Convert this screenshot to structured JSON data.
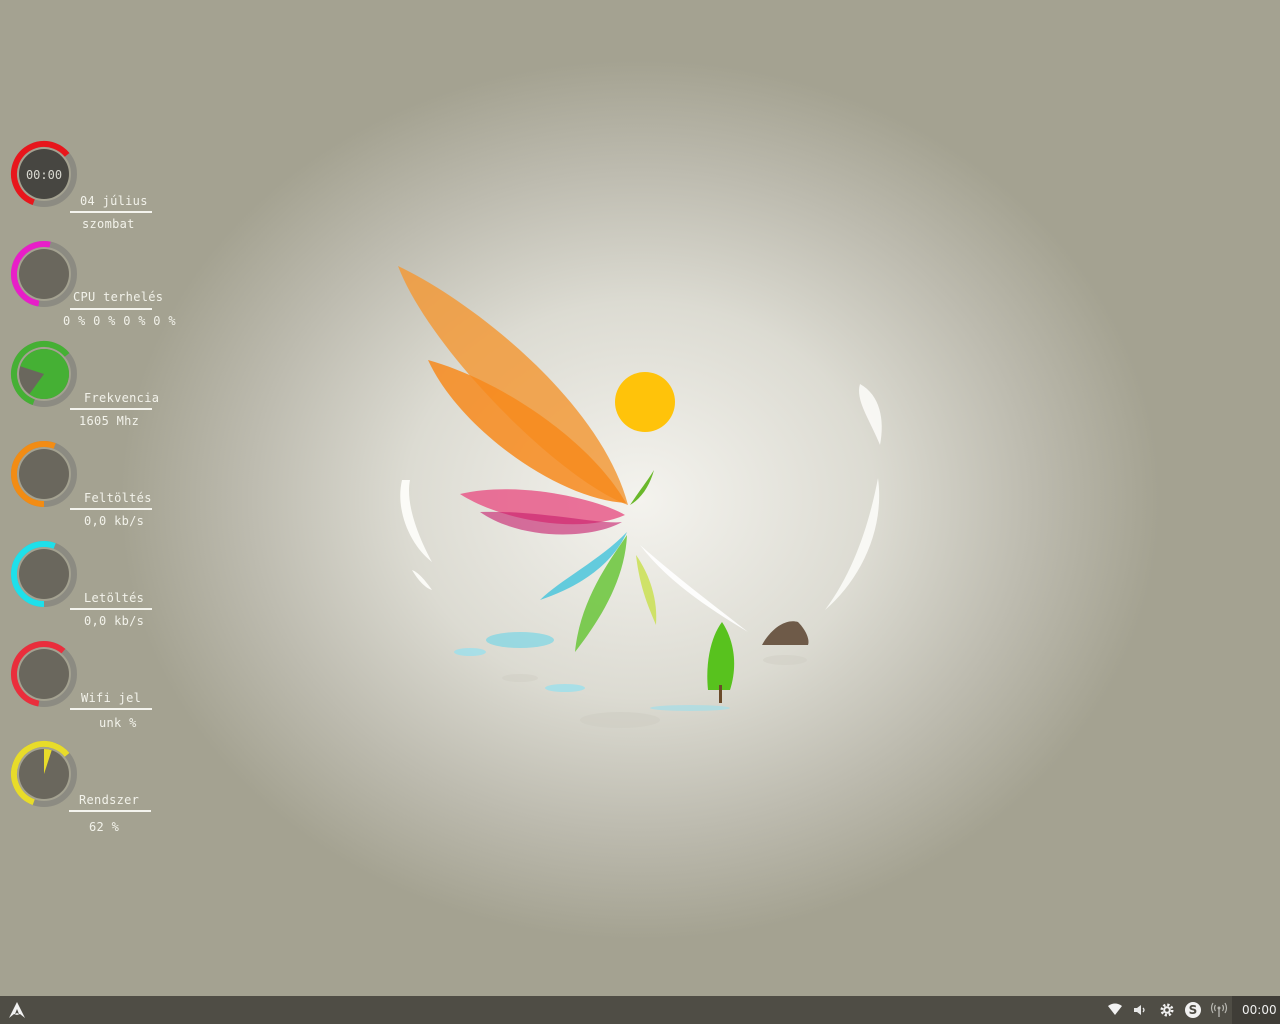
{
  "colors": {
    "clock_ring": "#e8161c",
    "cpu_ring": "#e81ec8",
    "freq_ring": "#45b034",
    "upload_ring": "#f28c14",
    "download_ring": "#1ee0ea",
    "wifi_ring": "#ea2e3c",
    "system_ring": "#e8dc2a",
    "gauge_track": "#8c8b82",
    "gauge_face": "#6a675d",
    "taskbar_bg": "#4f4d45"
  },
  "widgets": {
    "clock": {
      "time": "00:00",
      "date": "04 július",
      "day": "szombat"
    },
    "cpu": {
      "label": "CPU terhelés",
      "value": "0 % 0 % 0 % 0 %",
      "level": 0
    },
    "frequency": {
      "label": "Frekvencia",
      "value": "1605 Mhz",
      "level": 0.8
    },
    "upload": {
      "label": "Feltöltés",
      "value": "0,0 kb/s",
      "level": 0
    },
    "download": {
      "label": "Letöltés",
      "value": "0,0 kb/s",
      "level": 0
    },
    "wifi": {
      "label": "Wifi jel",
      "value": "unk %",
      "level": 0
    },
    "system": {
      "label": "Rendszer",
      "value": "62 %",
      "level": 0.05
    }
  },
  "taskbar": {
    "start_icon": "arch-logo-icon",
    "tray_icons": [
      "wifi-icon",
      "volume-icon",
      "settings-gear-icon",
      "skype-icon",
      "network-antenna-icon"
    ],
    "clock": "00:00"
  }
}
